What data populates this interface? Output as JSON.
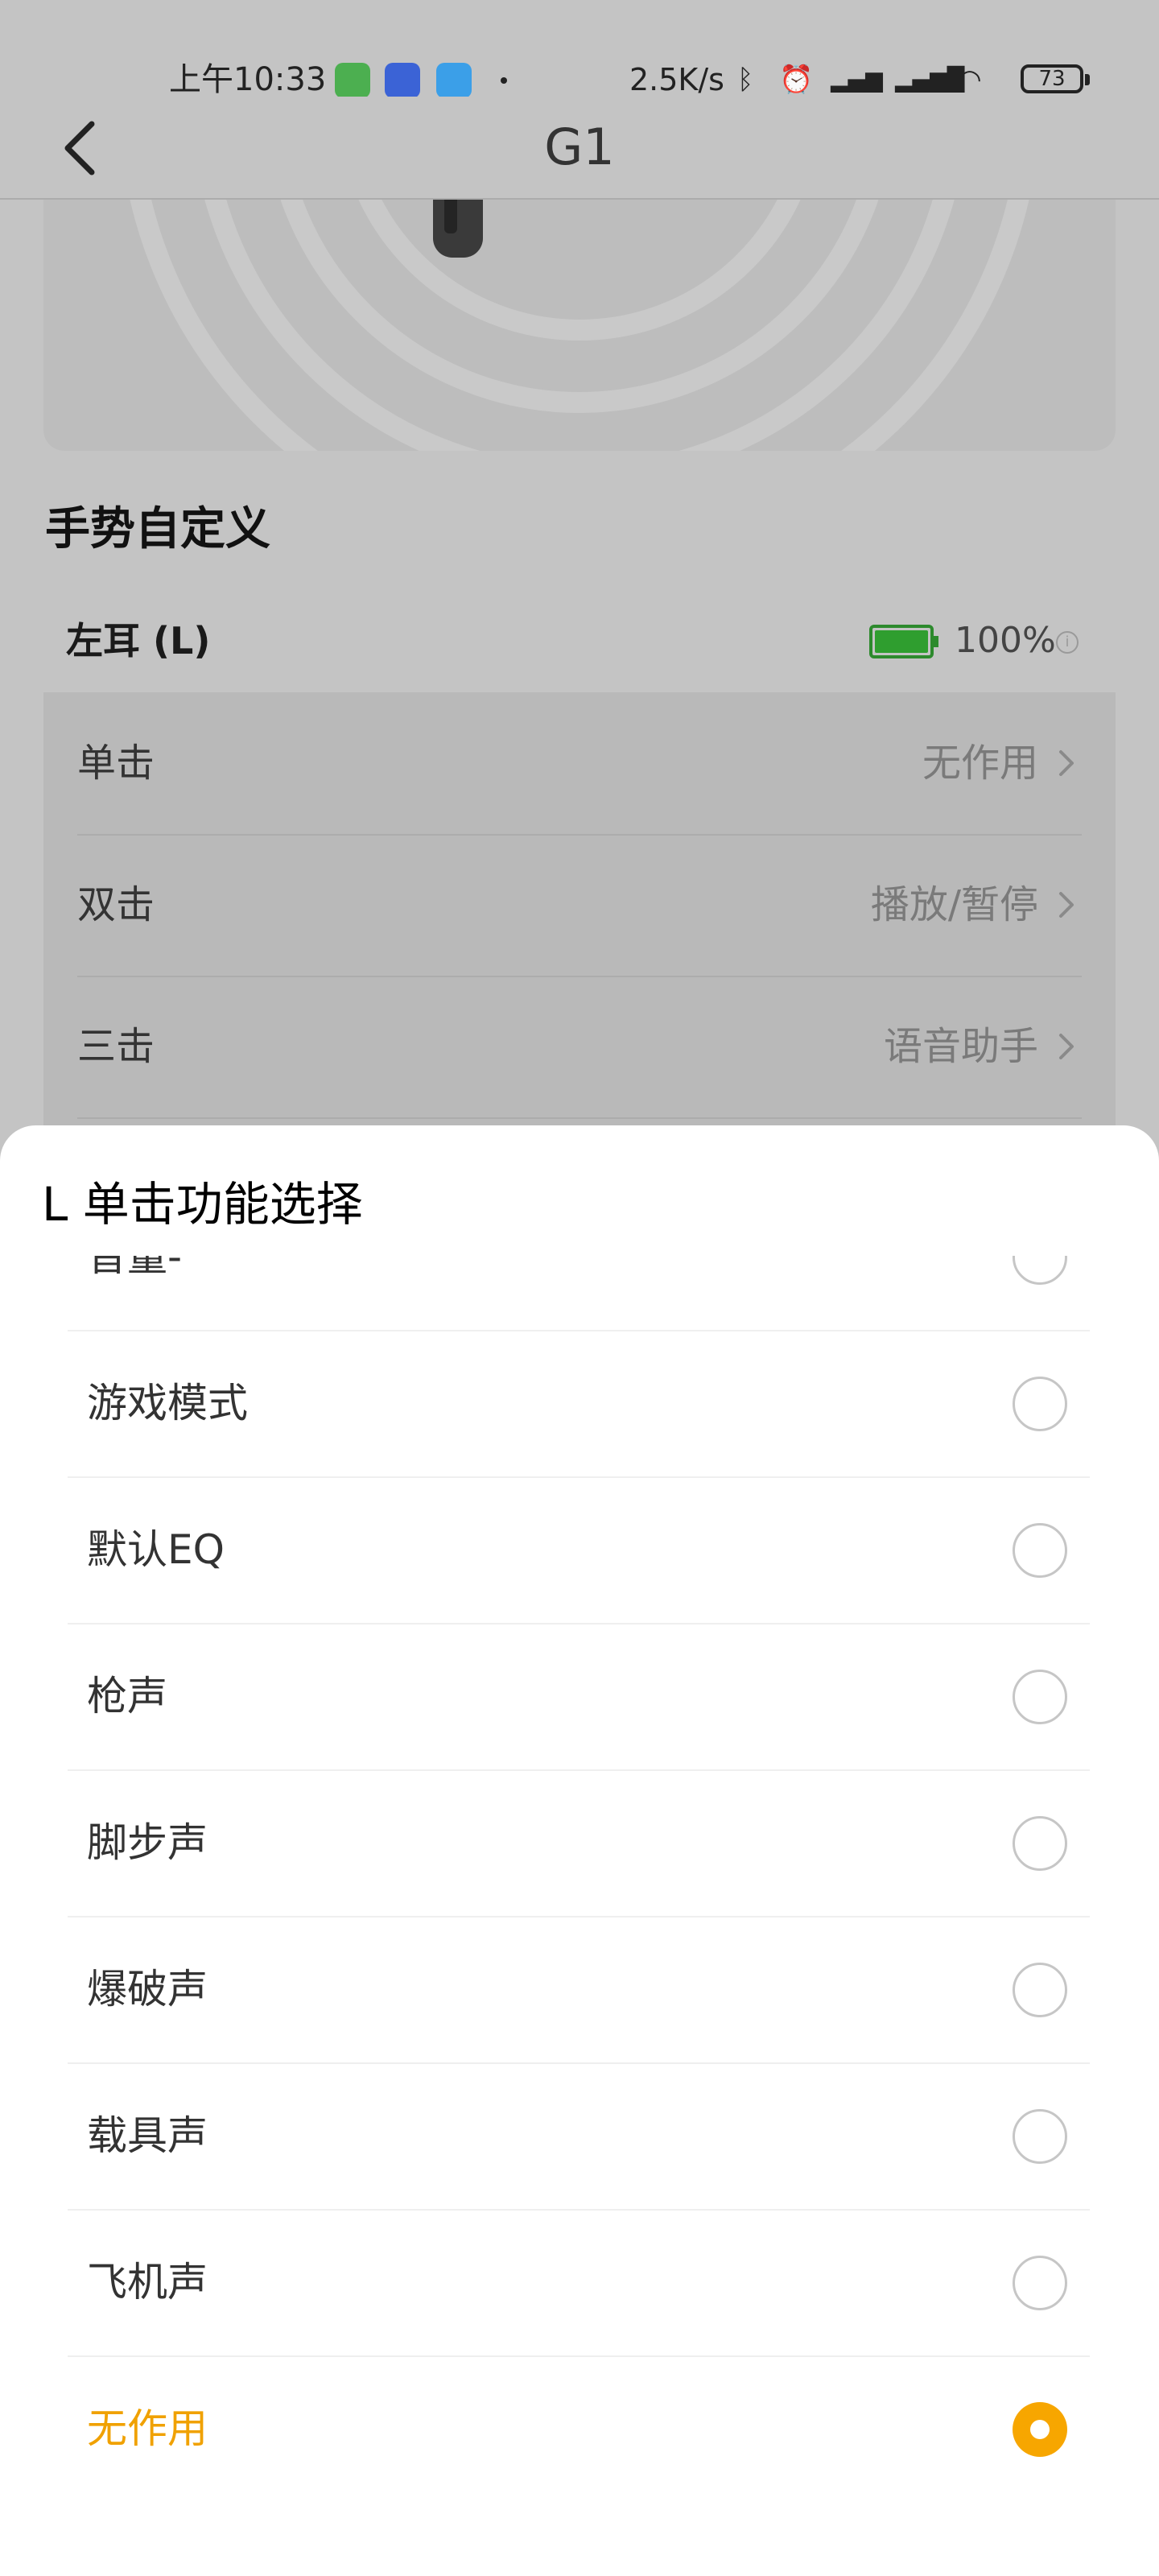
{
  "status_bar": {
    "time": "上午10:33",
    "net_speed": "2.5K/s",
    "battery": "73",
    "icons": [
      "wechat-icon",
      "app-icon",
      "feishu-icon",
      "bluetooth-icon",
      "alarm-icon",
      "hd-signal-icon",
      "signal-icon",
      "wifi-icon"
    ]
  },
  "header": {
    "title": "G1",
    "back_icon": "chevron-left-icon"
  },
  "gesture": {
    "section_title": "手势自定义",
    "ear_label": "左耳 (L)",
    "battery_percent": "100%",
    "battery_level": 1.0,
    "battery_color": "#2f9e2f",
    "rows": [
      {
        "name": "单击",
        "value": "无作用"
      },
      {
        "name": "双击",
        "value": "播放/暂停"
      },
      {
        "name": "三击",
        "value": "语音助手"
      }
    ]
  },
  "sheet": {
    "title": "L 单击功能选择",
    "accent_color": "#f7a600",
    "options": [
      {
        "label": "音量-",
        "selected": false
      },
      {
        "label": "游戏模式",
        "selected": false
      },
      {
        "label": "默认EQ",
        "selected": false
      },
      {
        "label": "枪声",
        "selected": false
      },
      {
        "label": "脚步声",
        "selected": false
      },
      {
        "label": "爆破声",
        "selected": false
      },
      {
        "label": "载具声",
        "selected": false
      },
      {
        "label": "飞机声",
        "selected": false
      },
      {
        "label": "无作用",
        "selected": true
      }
    ]
  }
}
